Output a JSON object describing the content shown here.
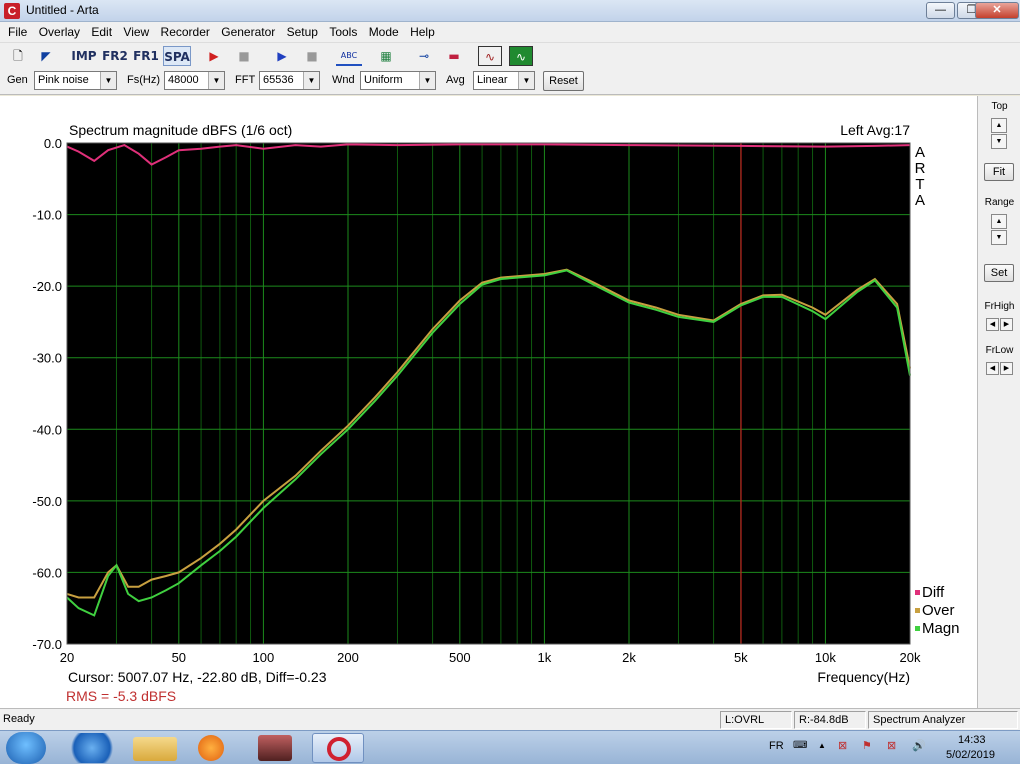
{
  "window": {
    "title": "Untitled - Arta",
    "app_icon": "C",
    "minimize": "—",
    "maximize": "❐",
    "close": "✕"
  },
  "menu": [
    "File",
    "Overlay",
    "Edit",
    "View",
    "Recorder",
    "Generator",
    "Setup",
    "Tools",
    "Mode",
    "Help"
  ],
  "toolbar": {
    "buttons": [
      {
        "name": "new-icon",
        "glyph": "🗋"
      },
      {
        "name": "open-icon",
        "glyph": "◤"
      },
      {
        "name": "imp-mode",
        "label": "IMP"
      },
      {
        "name": "fr2-mode",
        "label": "FR2"
      },
      {
        "name": "fr1-mode",
        "label": "FR1"
      },
      {
        "name": "spa-mode",
        "label": "SPA"
      },
      {
        "name": "record-icon",
        "glyph": "▶"
      },
      {
        "name": "stop-icon",
        "glyph": "■"
      },
      {
        "name": "play-icon",
        "glyph": "▶"
      },
      {
        "name": "stop2-icon",
        "glyph": "■"
      },
      {
        "name": "abc-icon",
        "glyph": "ABC"
      },
      {
        "name": "pattern-icon",
        "glyph": "▦"
      },
      {
        "name": "slider-icon",
        "glyph": "⊸"
      },
      {
        "name": "meter-icon",
        "glyph": "▬"
      },
      {
        "name": "wave-icon",
        "glyph": "∿"
      },
      {
        "name": "scope-icon",
        "glyph": "∿"
      }
    ]
  },
  "controls": {
    "gen_label": "Gen",
    "gen_value": "Pink noise",
    "fs_label": "Fs(Hz)",
    "fs_value": "48000",
    "fft_label": "FFT",
    "fft_value": "65536",
    "wnd_label": "Wnd",
    "wnd_value": "Uniform",
    "avg_label": "Avg",
    "avg_value": "Linear",
    "reset_label": "Reset"
  },
  "right_panel": {
    "top_label": "Top",
    "fit_label": "Fit",
    "range_label": "Range",
    "set_label": "Set",
    "frhigh_label": "FrHigh",
    "frlow_label": "FrLow"
  },
  "plot_info": {
    "cursor_text": "Cursor:  5007.07 Hz, -22.80 dB,  Diff=-0.23",
    "rms_text": "RMS =   -5.3 dBFS",
    "arta_watermark": "ARTA"
  },
  "status": {
    "ready": "Ready",
    "left_level": "L:OVRL",
    "right_level": "R:-84.8dB",
    "mode": "Spectrum Analyzer"
  },
  "taskbar": {
    "lang": "FR",
    "time": "14:33",
    "date": "5/02/2019"
  },
  "chart_data": {
    "type": "line",
    "title": "Spectrum magnitude dBFS (1/6 oct)",
    "subtitle": "Left  Avg:17",
    "xlabel": "Frequency(Hz)",
    "ylabel": "",
    "x_scale": "log",
    "xlim": [
      20,
      20000
    ],
    "ylim": [
      -70,
      0
    ],
    "grid": true,
    "background": "#000000",
    "x_ticks": [
      {
        "v": 20,
        "label": "20"
      },
      {
        "v": 50,
        "label": "50"
      },
      {
        "v": 100,
        "label": "100"
      },
      {
        "v": 200,
        "label": "200"
      },
      {
        "v": 500,
        "label": "500"
      },
      {
        "v": 1000,
        "label": "1k"
      },
      {
        "v": 2000,
        "label": "2k"
      },
      {
        "v": 5000,
        "label": "5k"
      },
      {
        "v": 10000,
        "label": "10k"
      },
      {
        "v": 20000,
        "label": "20k"
      }
    ],
    "y_ticks": [
      {
        "v": 0,
        "label": "0.0"
      },
      {
        "v": -10,
        "label": "-10.0"
      },
      {
        "v": -20,
        "label": "-20.0"
      },
      {
        "v": -30,
        "label": "-30.0"
      },
      {
        "v": -40,
        "label": "-40.0"
      },
      {
        "v": -50,
        "label": "-50.0"
      },
      {
        "v": -60,
        "label": "-60.0"
      },
      {
        "v": -70,
        "label": "-70.0"
      }
    ],
    "legend_position": "bottom-right",
    "cursor_freq": 5007.07,
    "series": [
      {
        "name": "Diff",
        "color": "#e0307a",
        "x": [
          20,
          22,
          25,
          28,
          32,
          36,
          40,
          45,
          50,
          60,
          70,
          80,
          100,
          130,
          160,
          200,
          300,
          500,
          1000,
          2000,
          5000,
          10000,
          15000,
          20000
        ],
        "y": [
          -0.5,
          -1.2,
          -2.5,
          -1.0,
          -0.3,
          -1.5,
          -3.0,
          -2.0,
          -1.0,
          -0.8,
          -0.5,
          -0.3,
          -0.8,
          -0.3,
          -0.5,
          -0.2,
          -0.3,
          -0.2,
          -0.2,
          -0.3,
          -0.4,
          -0.5,
          -0.4,
          -0.3
        ]
      },
      {
        "name": "Over",
        "color": "#c8a040",
        "x": [
          20,
          22,
          25,
          28,
          30,
          33,
          36,
          40,
          45,
          50,
          60,
          70,
          80,
          100,
          130,
          160,
          200,
          250,
          300,
          400,
          500,
          600,
          700,
          1000,
          1200,
          1500,
          2000,
          2500,
          3000,
          4000,
          5000,
          6000,
          7000,
          9000,
          10000,
          13000,
          15000,
          18000,
          20000
        ],
        "y": [
          -63.0,
          -63.5,
          -63.5,
          -60.0,
          -59.0,
          -62.0,
          -62.0,
          -61.0,
          -60.5,
          -60.0,
          -58.0,
          -56.0,
          -54.0,
          -50.0,
          -46.5,
          -43.0,
          -39.5,
          -35.5,
          -32.0,
          -26.0,
          -22.0,
          -19.5,
          -18.8,
          -18.3,
          -17.7,
          -19.5,
          -22.0,
          -23.0,
          -24.0,
          -24.8,
          -22.5,
          -21.3,
          -21.2,
          -23.0,
          -24.0,
          -20.5,
          -19.0,
          -22.5,
          -31.5
        ]
      },
      {
        "name": "Magn",
        "color": "#40d040",
        "x": [
          20,
          22,
          25,
          28,
          30,
          33,
          36,
          40,
          45,
          50,
          60,
          70,
          80,
          100,
          130,
          160,
          200,
          250,
          300,
          400,
          500,
          600,
          700,
          1000,
          1200,
          1500,
          2000,
          2500,
          3000,
          4000,
          5000,
          6000,
          7000,
          9000,
          10000,
          13000,
          15000,
          18000,
          20000
        ],
        "y": [
          -63.5,
          -65.0,
          -66.0,
          -60.5,
          -59.0,
          -63.0,
          -64.0,
          -63.5,
          -62.5,
          -61.5,
          -59.0,
          -57.0,
          -55.0,
          -51.0,
          -47.0,
          -43.5,
          -40.0,
          -36.0,
          -32.5,
          -26.5,
          -22.5,
          -19.8,
          -19.0,
          -18.5,
          -17.8,
          -19.8,
          -22.3,
          -23.3,
          -24.3,
          -25.0,
          -22.7,
          -21.5,
          -21.5,
          -23.5,
          -24.6,
          -20.8,
          -19.2,
          -23.0,
          -32.5
        ]
      }
    ]
  }
}
